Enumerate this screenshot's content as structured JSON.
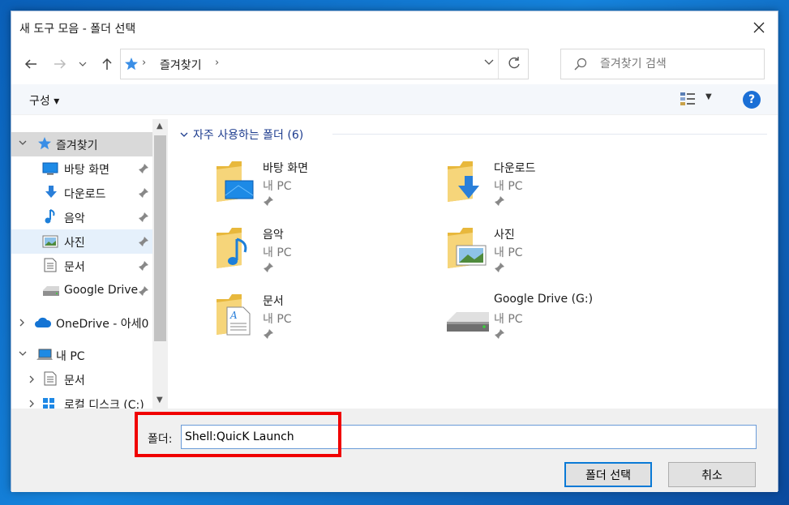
{
  "window": {
    "title": "새 도구 모음 - 폴더 선택"
  },
  "address": {
    "crumb": "즐겨찾기"
  },
  "search": {
    "placeholder": "즐겨찾기 검색"
  },
  "toolbar": {
    "organize": "구성 ▾",
    "help": "?"
  },
  "sidebar": {
    "items": [
      {
        "label": "즐겨찾기",
        "icon": "star-icon"
      },
      {
        "label": "바탕 화면",
        "icon": "desktop-icon"
      },
      {
        "label": "다운로드",
        "icon": "download-icon"
      },
      {
        "label": "음악",
        "icon": "music-icon"
      },
      {
        "label": "사진",
        "icon": "pictures-icon"
      },
      {
        "label": "문서",
        "icon": "documents-icon"
      },
      {
        "label": "Google Drive",
        "icon": "drive-icon"
      },
      {
        "label": "OneDrive - 아세0",
        "icon": "onedrive-icon"
      },
      {
        "label": "내 PC",
        "icon": "pc-icon"
      },
      {
        "label": "문서",
        "icon": "documents-icon"
      },
      {
        "label": "로컬 디스크 (C:)",
        "icon": "disk-icon"
      }
    ]
  },
  "content": {
    "group_header": "자주 사용하는 폴더 (6)",
    "tiles": [
      {
        "name": "바탕 화면",
        "sub": "내 PC",
        "icon": "desktop-folder-icon"
      },
      {
        "name": "다운로드",
        "sub": "내 PC",
        "icon": "downloads-folder-icon"
      },
      {
        "name": "음악",
        "sub": "내 PC",
        "icon": "music-folder-icon"
      },
      {
        "name": "사진",
        "sub": "내 PC",
        "icon": "pictures-folder-icon"
      },
      {
        "name": "문서",
        "sub": "내 PC",
        "icon": "documents-folder-icon"
      },
      {
        "name": "Google Drive (G:)",
        "sub": "내 PC",
        "icon": "drive-icon"
      }
    ]
  },
  "footer": {
    "folder_label": "폴더:",
    "folder_value": "Shell:QuicK Launch",
    "select_button": "폴더 선택",
    "cancel_button": "취소"
  },
  "colors": {
    "accent": "#1a6fd6",
    "highlight": "#f00000",
    "selection": "#e5f0fb"
  }
}
